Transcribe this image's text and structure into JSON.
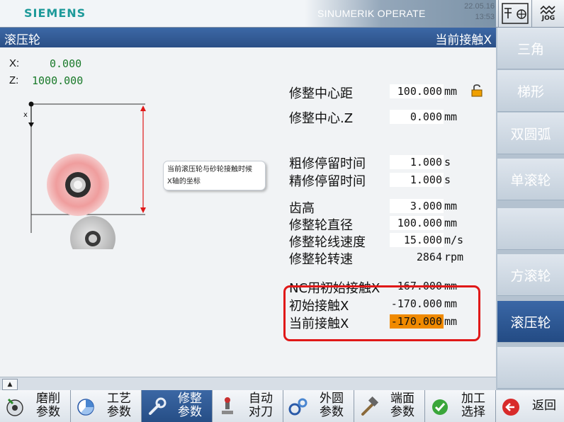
{
  "header": {
    "brand": "SIEMENS",
    "hmi_name": "SINUMERIK OPERATE",
    "date": "22.05.16",
    "time": "13:53",
    "mode": "JOG"
  },
  "window": {
    "title": "滚压轮",
    "current_item": "当前接触X"
  },
  "coords": [
    {
      "axis": "X:",
      "value": "0.000"
    },
    {
      "axis": "Z:",
      "value": "1000.000"
    }
  ],
  "diagram": {
    "axis_label": "x",
    "callout_line1": "当前滚压轮与砂轮接触时候",
    "callout_line2": "X轴的坐标"
  },
  "params": [
    {
      "label": "修整中心距",
      "value": "100.000",
      "unit": "mm"
    },
    {
      "label": "修整中心.Z",
      "value": "0.000",
      "unit": "mm"
    },
    {
      "label": "粗修停留时间",
      "value": "1.000",
      "unit": "s"
    },
    {
      "label": "精修停留时间",
      "value": "1.000",
      "unit": "s"
    },
    {
      "label": "齿高",
      "value": "3.000",
      "unit": "mm"
    },
    {
      "label": "修整轮直径",
      "value": "100.000",
      "unit": "mm"
    },
    {
      "label": "修整轮线速度",
      "value": "15.000",
      "unit": "m/s"
    },
    {
      "label": "修整轮转速",
      "value": "2864",
      "unit": "rpm"
    },
    {
      "label": "NC用初始接触X",
      "value": "-167.000",
      "unit": "mm"
    },
    {
      "label": "初始接触X",
      "value": "-170.000",
      "unit": "mm"
    },
    {
      "label": "当前接触X",
      "value": "-170.000",
      "unit": "mm"
    }
  ],
  "vertical_softkeys": [
    "三角",
    "梯形",
    "双圆弧",
    "单滚轮",
    "",
    "方滚轮",
    "滚压轮",
    ""
  ],
  "horizontal_softkeys": [
    {
      "line1": "磨削",
      "line2": "参数"
    },
    {
      "line1": "工艺",
      "line2": "参数"
    },
    {
      "line1": "修整",
      "line2": "参数"
    },
    {
      "line1": "自动",
      "line2": "对刀"
    },
    {
      "line1": "外圆",
      "line2": "参数"
    },
    {
      "line1": "端面",
      "line2": "参数"
    },
    {
      "line1": "加工",
      "line2": "选择"
    },
    {
      "line1": "返回",
      "line2": ""
    }
  ],
  "colors": {
    "accent": "#2b4f86",
    "highlight": "#f08a00",
    "frame": "#e01818",
    "value_green": "#1a7a2a"
  }
}
